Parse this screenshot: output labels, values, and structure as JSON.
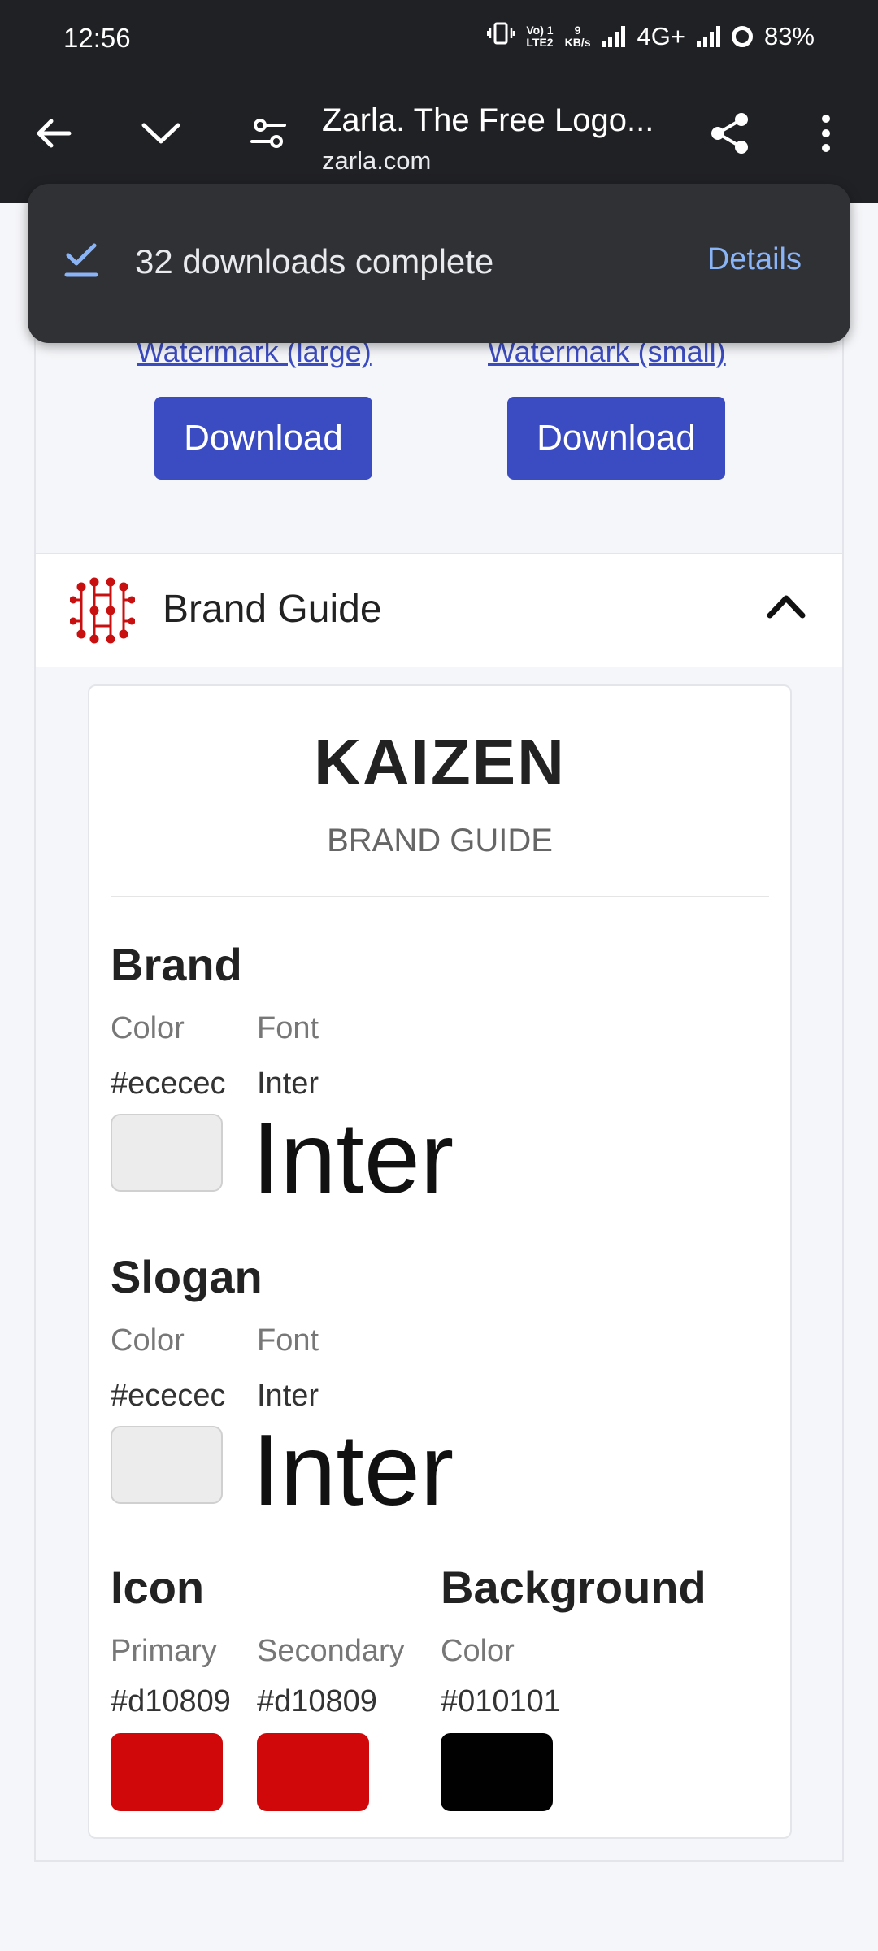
{
  "status_bar": {
    "time": "12:56",
    "net_top": "Vo) 1",
    "net_bottom": "LTE2",
    "speed_top": "9",
    "speed_bottom": "KB/s",
    "network": "4G+",
    "battery": "83%"
  },
  "toolbar": {
    "title": "Zarla. The Free Logo...",
    "url": "zarla.com"
  },
  "snackbar": {
    "message": "32 downloads complete",
    "action": "Details"
  },
  "watermark": {
    "large_label": "Watermark (large)",
    "small_label": "Watermark (small)",
    "download_label": "Download"
  },
  "brand_guide": {
    "header_label": "Brand Guide",
    "name": "KAIZEN",
    "subtitle": "BRAND GUIDE",
    "brand": {
      "title": "Brand",
      "color_label": "Color",
      "font_label": "Font",
      "color": "#ececec",
      "font": "Inter",
      "sample": "Inter"
    },
    "slogan": {
      "title": "Slogan",
      "color_label": "Color",
      "font_label": "Font",
      "color": "#ececec",
      "font": "Inter",
      "sample": "Inter"
    },
    "icon": {
      "title": "Icon",
      "primary_label": "Primary",
      "secondary_label": "Secondary",
      "primary": "#d10809",
      "secondary": "#d10809"
    },
    "background": {
      "title": "Background",
      "color_label": "Color",
      "color": "#010101"
    }
  }
}
